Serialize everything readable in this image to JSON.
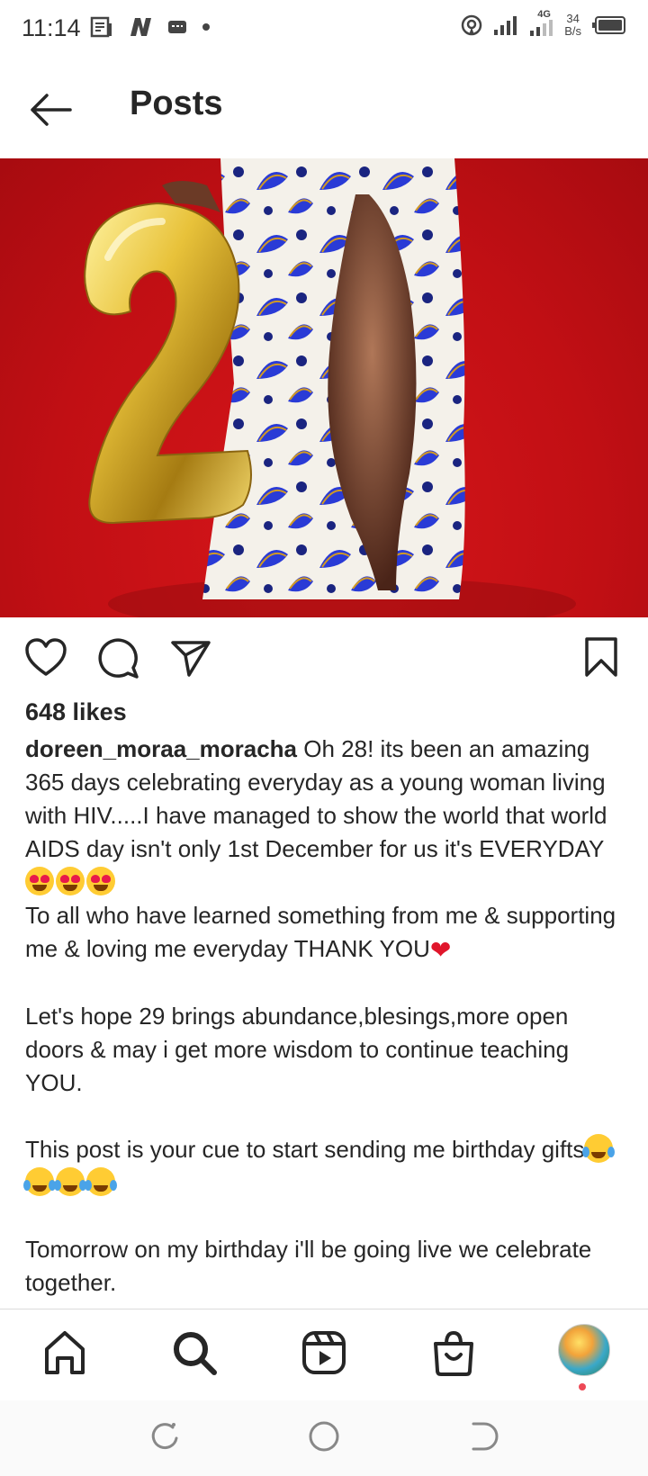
{
  "status": {
    "time": "11:14",
    "network": "4G",
    "speed_value": "34",
    "speed_unit": "B/s"
  },
  "header": {
    "title": "Posts"
  },
  "post": {
    "likes": "648 likes",
    "username": "doreen_moraa_moracha",
    "caption_p1": " Oh 28! its been an amazing 365 days celebrating everyday as a young woman living with HIV.....I have managed to show the world that world AIDS day isn't only 1st December for us it's EVERYDAY",
    "caption_p2": "To all who have learned something from me & supporting me & loving me everyday THANK YOU",
    "caption_p3": "Let's hope 29 brings abundance,blesings,more open doors & may i get more wisdom to continue teaching YOU.",
    "caption_p4": "This post is your cue to start sending me birthday gifts",
    "caption_p5": "Tomorrow on my birthday i'll be going live we celebrate together.",
    "balloon_number": "2"
  },
  "nav": {
    "items": [
      "home",
      "search",
      "reels",
      "shop",
      "profile"
    ]
  },
  "colors": {
    "photo_bg": "#c10f14",
    "notification_dot": "#ed4956",
    "skirt_blue": "#2a3bd6"
  }
}
